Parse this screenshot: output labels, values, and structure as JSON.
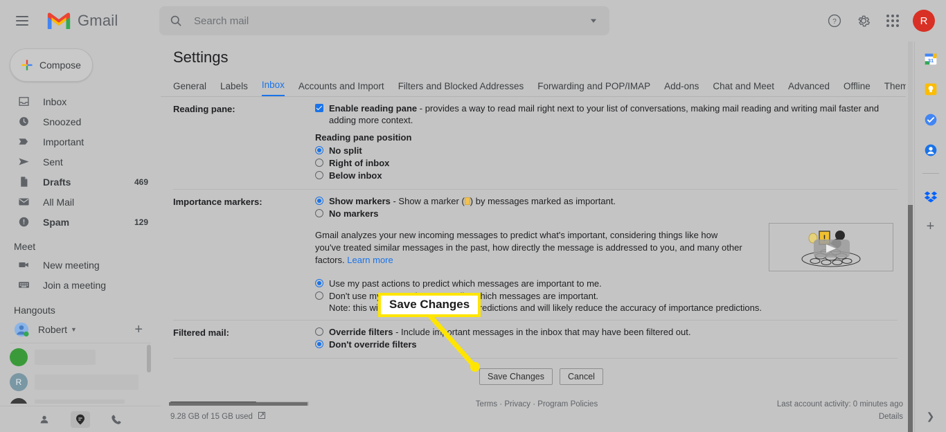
{
  "app": {
    "brand": "Gmail",
    "avatar_initial": "R",
    "accent_blue": "#1a73e8",
    "avatar_color": "#d93025",
    "annotation_yellow": "#ffe500"
  },
  "search": {
    "placeholder": "Search mail",
    "value": ""
  },
  "topbar": {
    "menu_icon": "hamburger-icon",
    "help_icon": "help-icon",
    "settings_icon": "gear-icon",
    "apps_icon": "apps-grid-icon"
  },
  "sidebar": {
    "compose_label": "Compose",
    "items": [
      {
        "label": "Inbox",
        "count": "",
        "icon": "inbox-icon",
        "bold": false
      },
      {
        "label": "Snoozed",
        "count": "",
        "icon": "clock-icon",
        "bold": false
      },
      {
        "label": "Important",
        "count": "",
        "icon": "important-marker-icon",
        "bold": false
      },
      {
        "label": "Sent",
        "count": "",
        "icon": "send-icon",
        "bold": false
      },
      {
        "label": "Drafts",
        "count": "469",
        "icon": "draft-file-icon",
        "bold": true
      },
      {
        "label": "All Mail",
        "count": "",
        "icon": "mail-stack-icon",
        "bold": false
      },
      {
        "label": "Spam",
        "count": "129",
        "icon": "spam-warning-icon",
        "bold": true
      }
    ],
    "meet": {
      "heading": "Meet",
      "items": [
        {
          "label": "New meeting",
          "icon": "video-camera-icon"
        },
        {
          "label": "Join a meeting",
          "icon": "keyboard-icon"
        }
      ]
    },
    "hangouts": {
      "heading": "Hangouts",
      "user_name": "Robert",
      "add_icon": "plus-icon",
      "caret_icon": "chevron-down-icon",
      "contacts": [
        {
          "avatar_initial": "",
          "avatar_color": "#3a9a3a"
        },
        {
          "avatar_initial": "R",
          "avatar_color": "#7a97a4"
        },
        {
          "avatar_initial": "",
          "avatar_color": "#3d3d3d"
        }
      ]
    },
    "bottom_icons": [
      {
        "name": "contacts-icon",
        "active": false
      },
      {
        "name": "hangouts-chat-icon",
        "active": true
      },
      {
        "name": "phone-icon",
        "active": false
      }
    ]
  },
  "settings": {
    "title": "Settings",
    "tabs": [
      {
        "label": "General",
        "active": false
      },
      {
        "label": "Labels",
        "active": false
      },
      {
        "label": "Inbox",
        "active": true
      },
      {
        "label": "Accounts and Import",
        "active": false
      },
      {
        "label": "Filters and Blocked Addresses",
        "active": false
      },
      {
        "label": "Forwarding and POP/IMAP",
        "active": false
      },
      {
        "label": "Add-ons",
        "active": false
      },
      {
        "label": "Chat and Meet",
        "active": false
      },
      {
        "label": "Advanced",
        "active": false
      },
      {
        "label": "Offline",
        "active": false
      },
      {
        "label": "Themes",
        "active": false
      }
    ],
    "reading_pane": {
      "label": "Reading pane:",
      "enable_bold": "Enable reading pane",
      "enable_rest": " - provides a way to read mail right next to your list of conversations, making mail reading and writing mail faster and adding more context.",
      "enable_checked": true,
      "position_label": "Reading pane position",
      "options": [
        {
          "label": "No split",
          "selected": true
        },
        {
          "label": "Right of inbox",
          "selected": false
        },
        {
          "label": "Below inbox",
          "selected": false
        }
      ]
    },
    "importance_markers": {
      "label": "Importance markers:",
      "show_bold": "Show markers",
      "show_pre": " - Show a marker (",
      "show_post": ") by messages marked as important.",
      "show_selected": true,
      "no_markers_label": "No markers",
      "no_markers_selected": false,
      "paragraph": "Gmail analyzes your new incoming messages to predict what's important, considering things like how you've treated similar messages in the past, how directly the message is addressed to you, and many other factors. ",
      "learn_more": "Learn more",
      "video_thumb": "importance-markers-video-thumbnail",
      "predictions": [
        {
          "label": "Use my past actions to predict which messages are important to me.",
          "selected": true
        },
        {
          "label": "Don't use my past actions to predict which messages are important.",
          "selected": false
        }
      ],
      "note": "Note: this will reset your importance predictions and will likely reduce the accuracy of importance predictions."
    },
    "filtered_mail": {
      "label": "Filtered mail:",
      "options": [
        {
          "bold": "Override filters",
          "rest": " - Include important messages in the inbox that may have been filtered out.",
          "selected": false
        },
        {
          "bold": "Don't override filters",
          "rest": "",
          "selected": true
        }
      ]
    },
    "buttons": {
      "save": "Save Changes",
      "cancel": "Cancel"
    }
  },
  "footer": {
    "storage_text": "9.28 GB of 15 GB used",
    "storage_percent": 62,
    "external_link_icon": "external-link-icon",
    "links": [
      {
        "label": "Terms"
      },
      {
        "label": "Privacy"
      },
      {
        "label": "Program Policies"
      }
    ],
    "separator": " · ",
    "last_activity": "Last account activity: 0 minutes ago",
    "details": "Details"
  },
  "rail": {
    "icons": [
      {
        "name": "google-calendar-icon"
      },
      {
        "name": "google-keep-icon"
      },
      {
        "name": "google-tasks-icon"
      },
      {
        "name": "google-contacts-icon"
      }
    ],
    "addon_icons": [
      {
        "name": "dropbox-icon"
      }
    ],
    "add_label": "+",
    "expand_icon": "chevron-right-icon"
  },
  "annotation": {
    "callout_text": "Save Changes",
    "pointer_target": "save-changes-button"
  }
}
